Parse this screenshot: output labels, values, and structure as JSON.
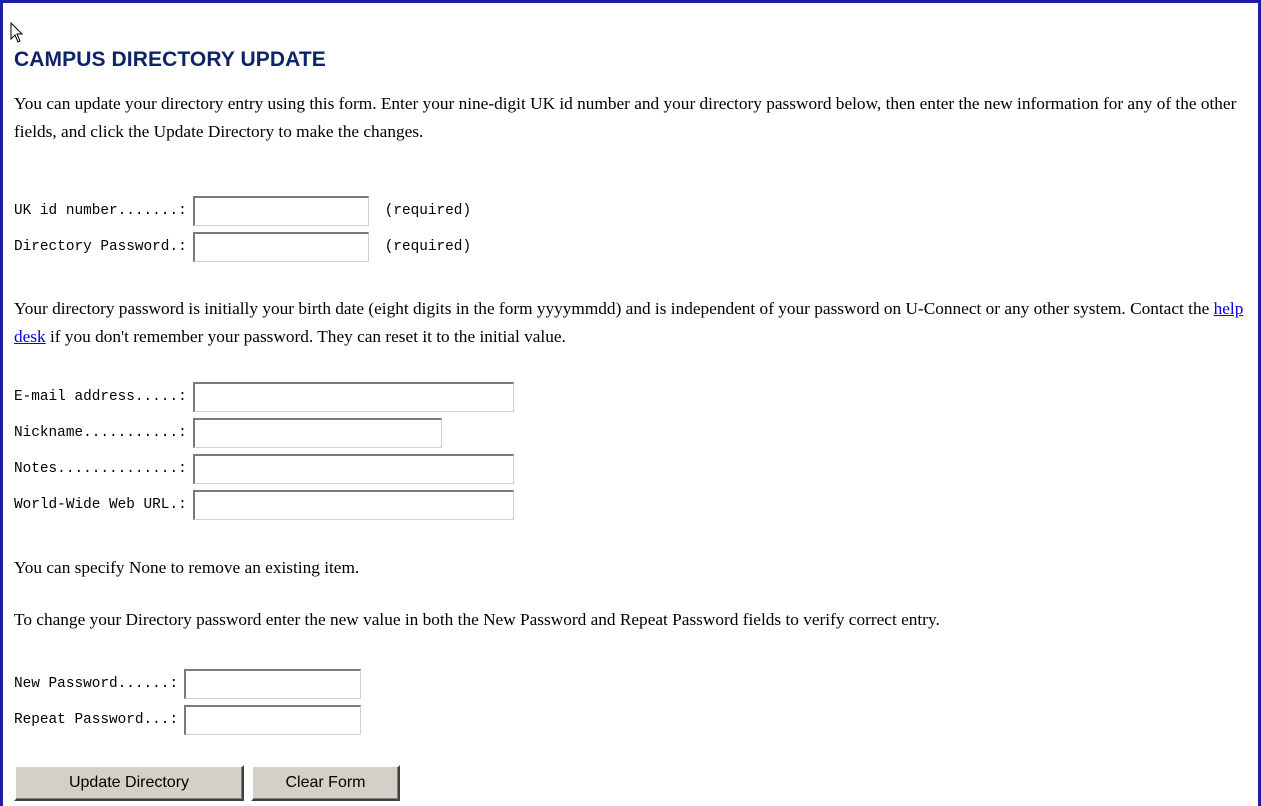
{
  "page": {
    "title": "CAMPUS DIRECTORY UPDATE",
    "intro": "You can update your directory entry using this form. Enter your nine-digit UK id number and your directory password below, then enter the new information for any of the other fields, and click the Update Directory to make the changes.",
    "password_note": {
      "before": "Your directory password is initially your birth date (eight digits in the form yyyymmdd) and is independent of your password on U-Connect or any other system. Contact the ",
      "link": "help desk",
      "after": " if you don't remember your password. They can reset it to the initial value."
    },
    "none_note": "You can specify None to remove an existing item.",
    "change_note": "To change your Directory password enter the new value in both the New Password and Repeat Password fields to verify correct entry."
  },
  "credentials": {
    "uk_id": {
      "label": "UK id number.......:",
      "value": "",
      "hint": "(required)"
    },
    "dir_password": {
      "label": "Directory Password.:",
      "value": "",
      "hint": "(required)"
    }
  },
  "profile": {
    "email": {
      "label": "E-mail address.....:",
      "value": ""
    },
    "nickname": {
      "label": "Nickname...........:",
      "value": ""
    },
    "notes": {
      "label": "Notes..............:",
      "value": ""
    },
    "url": {
      "label": "World-Wide Web URL.:",
      "value": ""
    }
  },
  "new_password": {
    "new": {
      "label": "New Password......:",
      "value": ""
    },
    "repeat": {
      "label": "Repeat Password...:",
      "value": ""
    }
  },
  "buttons": {
    "update": "Update Directory",
    "clear": "Clear Form"
  },
  "colors": {
    "frame_border": "#1f1fa5",
    "title": "#0f2468",
    "link": "#0000ee",
    "button_face": "#d4d0c8"
  },
  "icons": {
    "cursor": "mouse-pointer-icon"
  }
}
